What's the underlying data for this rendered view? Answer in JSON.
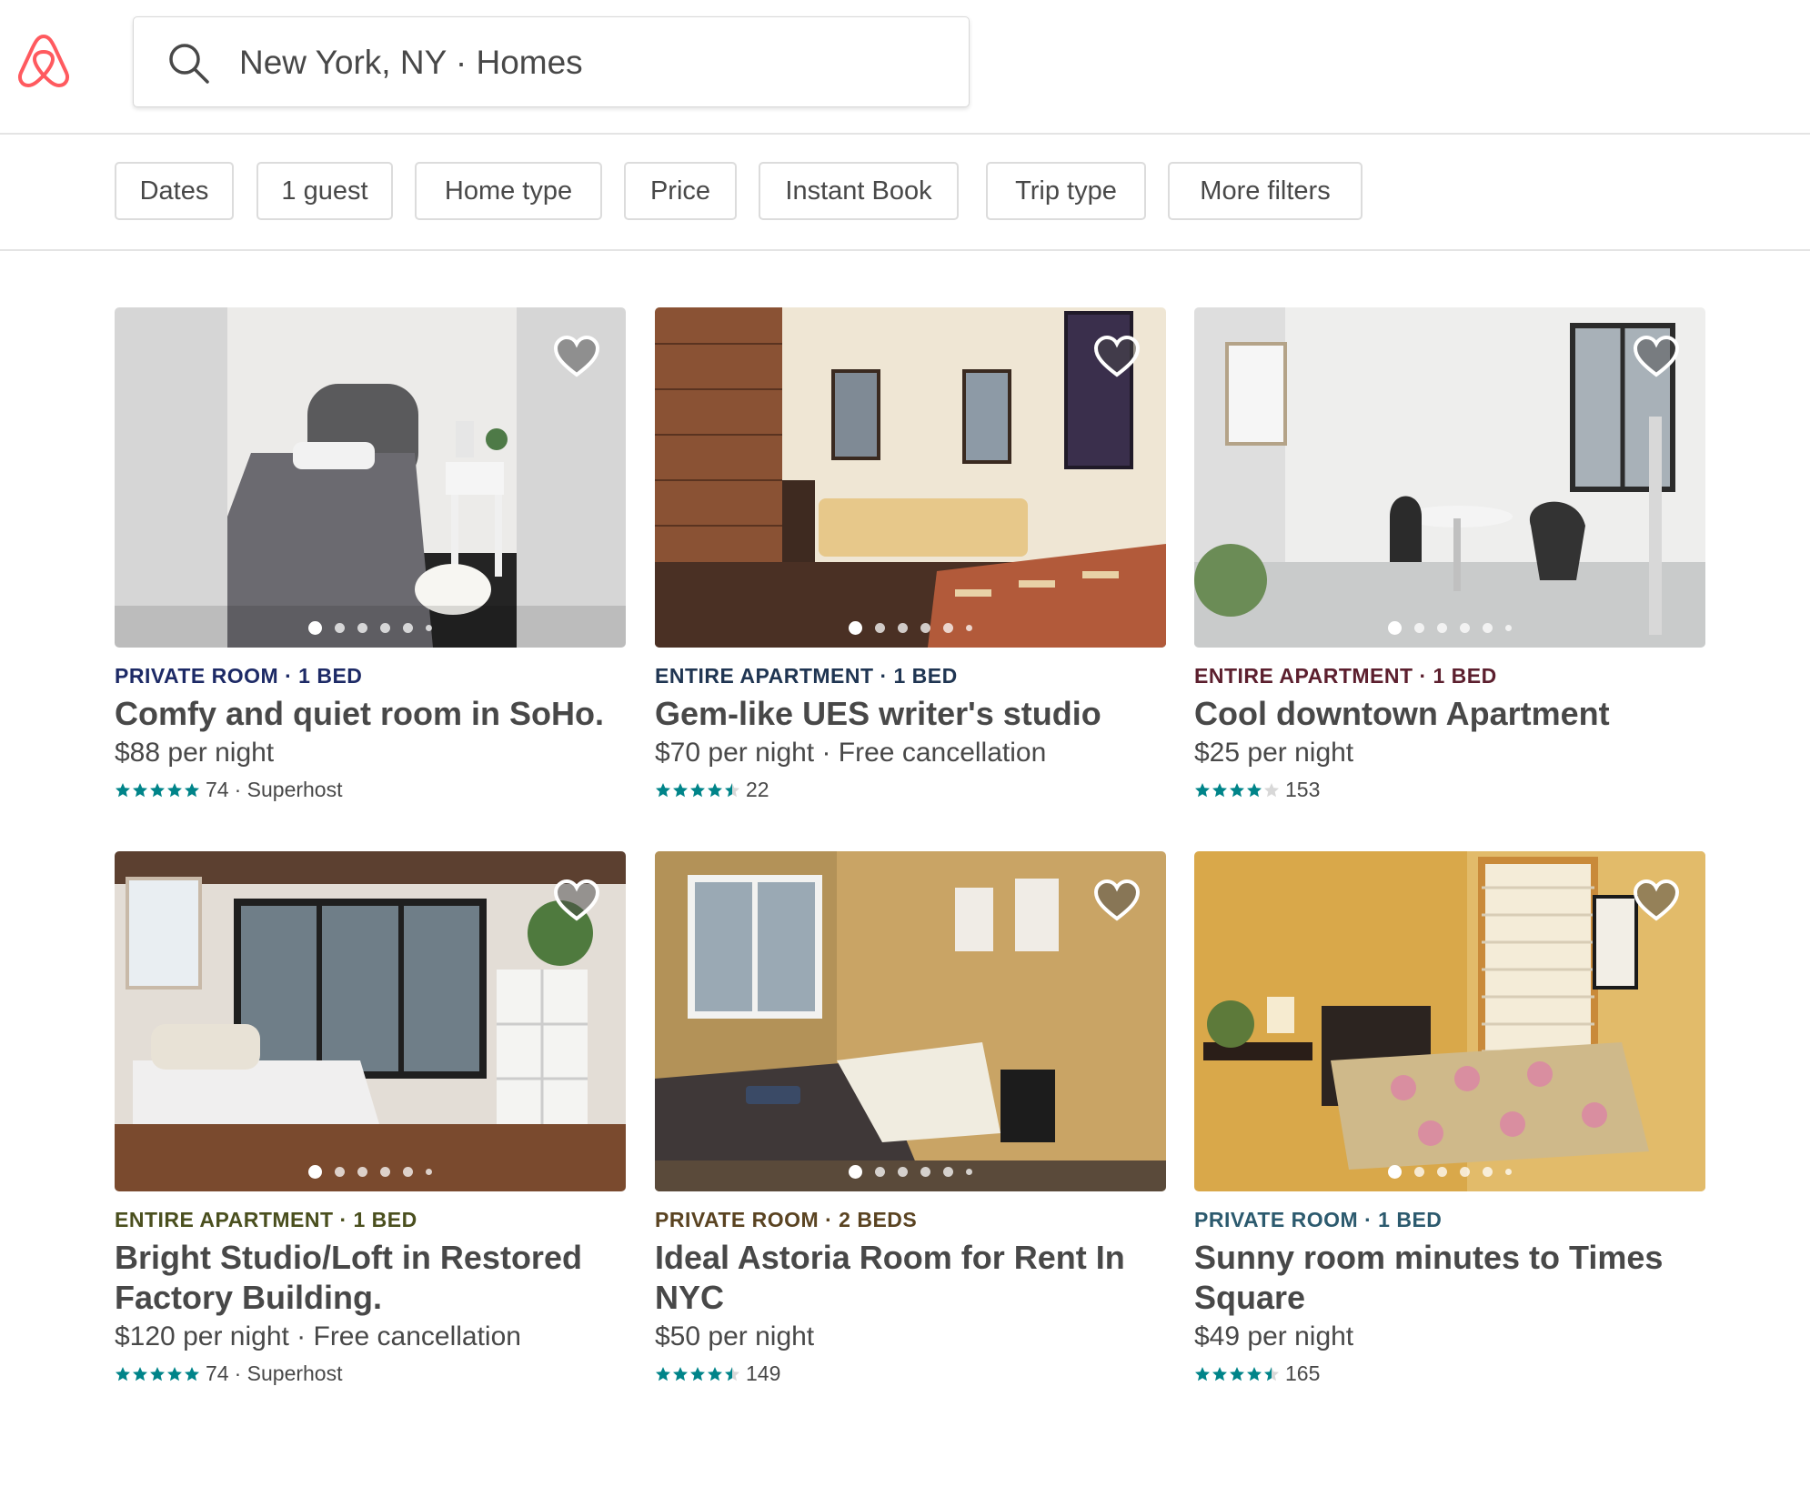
{
  "search": {
    "value": "New York, NY · Homes"
  },
  "filters": [
    "Dates",
    "1 guest",
    "Home type",
    "Price",
    "Instant Book",
    "Trip type",
    "More filters"
  ],
  "colors": {
    "brand": "#FF5A5F",
    "star": "#008489",
    "text": "#484848"
  },
  "listings": [
    {
      "kicker": "PRIVATE ROOM · 1 BED",
      "kicker_color": "#1d2a66",
      "title": "Comfy and quiet room in SoHo.",
      "price": "$88",
      "price_suffix": " per night",
      "rating": 5,
      "reviews": "74",
      "extra": " · Superhost"
    },
    {
      "kicker": "ENTIRE APARTMENT · 1 BED",
      "kicker_color": "#1f3552",
      "title": "Gem-like UES writer's studio",
      "price": "$70",
      "price_suffix": " per night · Free cancellation",
      "rating": 4.5,
      "reviews": "22",
      "extra": ""
    },
    {
      "kicker": "ENTIRE APARTMENT · 1 BED",
      "kicker_color": "#5c1f2e",
      "title": "Cool downtown Apartment",
      "price": "$25",
      "price_suffix": " per night",
      "rating": 4,
      "reviews": "153",
      "extra": ""
    },
    {
      "kicker": "ENTIRE APARTMENT · 1 BED",
      "kicker_color": "#4a4f1e",
      "title": "Bright Studio/Loft in Restored Factory Building.",
      "price": "$120",
      "price_suffix": " per night · Free cancellation",
      "rating": 5,
      "reviews": "74",
      "extra": " · Superhost"
    },
    {
      "kicker": "PRIVATE ROOM · 2 BEDS",
      "kicker_color": "#5a4321",
      "title": "Ideal Astoria Room for Rent In NYC",
      "price": "$50",
      "price_suffix": " per night",
      "rating": 4.5,
      "reviews": "149",
      "extra": ""
    },
    {
      "kicker": "PRIVATE ROOM · 1 BED",
      "kicker_color": "#2c5a6e",
      "title": "Sunny room minutes to Times Square",
      "price": "$49",
      "price_suffix": " per night",
      "rating": 4.5,
      "reviews": "165",
      "extra": ""
    }
  ]
}
